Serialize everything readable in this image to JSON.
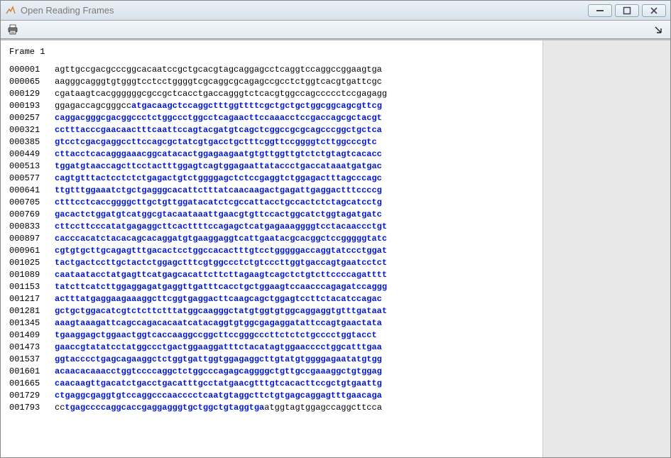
{
  "window": {
    "title": "Open Reading Frames"
  },
  "frame_label": "Frame 1",
  "rows": [
    {
      "pos": "000001",
      "segs": [
        {
          "c": "plain",
          "t": "agttgccgacgcccggcacaatccgctgcacgtagcaggagcctcaggtccaggccggaagtga"
        }
      ]
    },
    {
      "pos": "000065",
      "segs": [
        {
          "c": "plain",
          "t": "aagggcagggtgtgggtcctcctggggtcgcaggcgcagagccgcctctggtcacgtgattcgc"
        }
      ]
    },
    {
      "pos": "000129",
      "segs": [
        {
          "c": "plain",
          "t": "cgataagtcacggggggcgccgctcacctgaccagggtctcacgtggccagccccctccgagagg"
        }
      ]
    },
    {
      "pos": "000193",
      "segs": [
        {
          "c": "plain",
          "t": "ggagaccagcgggcc"
        },
        {
          "c": "orf",
          "t": "atgacaagctccaggctttggttttcgctgctgctggcggcagcgttcg"
        }
      ]
    },
    {
      "pos": "000257",
      "segs": [
        {
          "c": "orf",
          "t": "caggacgggcgacggccctctggccctggcctcagaacttccaaacctccgaccagcgctacgt"
        }
      ]
    },
    {
      "pos": "000321",
      "segs": [
        {
          "c": "orf",
          "t": "cctttacccgaacaactttcaattccagtacgatgtcagctcggccgcgcagcccggctgctca"
        }
      ]
    },
    {
      "pos": "000385",
      "segs": [
        {
          "c": "orf",
          "t": "gtcctcgacgaggccttccagcgctatcgtgacctgctttcggttccggggtcttggcccgtc"
        }
      ]
    },
    {
      "pos": "000449",
      "segs": [
        {
          "c": "orf",
          "t": "cttacctcacagggaaacggcatacactggagaagaatgtgttggttgtctctgtagtcacacc"
        }
      ]
    },
    {
      "pos": "000513",
      "segs": [
        {
          "c": "orf",
          "t": "tggatgtaaccagcttcctactttggagtcagtggagaattataccctgaccataaatgatgac"
        }
      ]
    },
    {
      "pos": "000577",
      "segs": [
        {
          "c": "orf",
          "t": "cagtgtttactcctctctgagactgtctggggagctctccgaggtctggagactttagcccagc"
        }
      ]
    },
    {
      "pos": "000641",
      "segs": [
        {
          "c": "orf",
          "t": "ttgtttggaaatctgctgagggcacattctttatcaacaagactgagattgaggactttccccg"
        }
      ]
    },
    {
      "pos": "000705",
      "segs": [
        {
          "c": "orf",
          "t": "ctttcctcaccggggcttgctgttggatacatctcgccattacctgccactctctagcatcctg"
        }
      ]
    },
    {
      "pos": "000769",
      "segs": [
        {
          "c": "orf",
          "t": "gacactctggatgtcatggcgtacaataaattgaacgtgttccactggcatctggtagatgatc"
        }
      ]
    },
    {
      "pos": "000833",
      "segs": [
        {
          "c": "orf",
          "t": "cttccttcccatatgagaggcttcacttttccagagctcatgagaaaggggtcctacaaccctgt"
        }
      ]
    },
    {
      "pos": "000897",
      "segs": [
        {
          "c": "orf",
          "t": "cacccacatctacacagcacaggatgtgaaggaggtcattgaatacgcacggctccgggggtatc"
        }
      ]
    },
    {
      "pos": "000961",
      "segs": [
        {
          "c": "orf",
          "t": "cgtgtgcttgcagagtttgacactcctggccacactttgtcctgggggaccaggtatccctggat"
        }
      ]
    },
    {
      "pos": "001025",
      "segs": [
        {
          "c": "orf",
          "t": "tactgactccttgctactctggagctttcgtggccctctgtcccttggtgaccagtgaatcctct"
        }
      ]
    },
    {
      "pos": "001089",
      "segs": [
        {
          "c": "orf",
          "t": "caataatacctatgagttcatgagcacattcttcttagaagtcagctctgtcttccccagatttt"
        }
      ]
    },
    {
      "pos": "001153",
      "segs": [
        {
          "c": "orf",
          "t": "tatcttcatcttggaggagatgaggttgatttcacctgctggaagtccaacccagagatccaggg"
        }
      ]
    },
    {
      "pos": "001217",
      "segs": [
        {
          "c": "orf",
          "t": "actttatgaggaagaaaggcttcggtgaggacttcaagcagctggagtccttctacatccagac"
        }
      ]
    },
    {
      "pos": "001281",
      "segs": [
        {
          "c": "orf",
          "t": "gctgctggacatcgtctcttctttatggcaagggctatgtggtgtggcaggaggtgtttgataat"
        }
      ]
    },
    {
      "pos": "001345",
      "segs": [
        {
          "c": "orf",
          "t": "aaagtaaagattcagccagacacaatcatacaggtgtggcgagaggatattccagtgaactata"
        }
      ]
    },
    {
      "pos": "001409",
      "segs": [
        {
          "c": "orf",
          "t": "tgaaggagctggaactggtcaccaaggccggcttccgggcccttctctctgcccctggtacct"
        }
      ]
    },
    {
      "pos": "001473",
      "segs": [
        {
          "c": "orf",
          "t": "gaaccgtatatcctatggccctgactggaaggatttctacatagtggaacccctggcatttgaa"
        }
      ]
    },
    {
      "pos": "001537",
      "segs": [
        {
          "c": "orf",
          "t": "ggtacccctgagcagaaggctctggtgattggtggagaggcttgtatgtggggagaatatgtgg"
        }
      ]
    },
    {
      "pos": "001601",
      "segs": [
        {
          "c": "orf",
          "t": "acaacacaaacctggtccccaggctctggcccagagcaggggctgttgccgaaaggctgtggag"
        }
      ]
    },
    {
      "pos": "001665",
      "segs": [
        {
          "c": "orf",
          "t": "caacaagttgacatctgacctgacatttgcctatgaacgtttgtcacacttccgctgtgaattg"
        }
      ]
    },
    {
      "pos": "001729",
      "segs": [
        {
          "c": "orf",
          "t": "ctgaggcgaggtgtccaggcccaacccctcaatgtaggcttctgtgagcaggagtttgaacaga"
        }
      ]
    },
    {
      "pos": "001793",
      "segs": [
        {
          "c": "plain",
          "t": "cc"
        },
        {
          "c": "orf",
          "t": "tgagccccaggcaccgaggagggtgctggctgtaggtga"
        },
        {
          "c": "plain",
          "t": "atggtagtggagccaggcttcca"
        }
      ]
    }
  ]
}
